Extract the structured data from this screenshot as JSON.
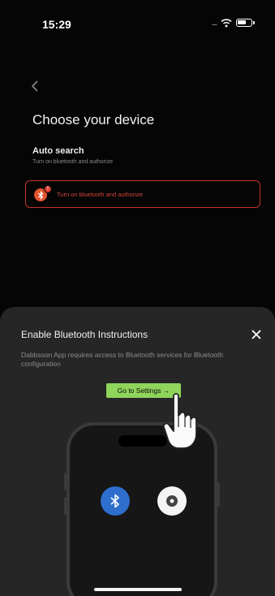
{
  "status_bar": {
    "time": "15:29",
    "signal": "....",
    "icons": [
      "signal-icon",
      "wifi-icon",
      "battery-icon"
    ]
  },
  "header": {
    "back_icon": "chevron-left-icon",
    "title": "Choose your device"
  },
  "auto_search": {
    "title": "Auto search",
    "subtitle": "Turn on bluetooth and authorize"
  },
  "bluetooth_button": {
    "label": "Turn on bluetooth and authorize",
    "icon": "bluetooth-alert-icon",
    "accent": "#d6453a"
  },
  "sheet": {
    "title": "Enable Bluetooth Instructions",
    "description": "Dabbsson App requires access to Bluetooth services for Bluetooth configuration",
    "settings_button": "Go to Settings →",
    "settings_accent": "#8fd45b",
    "close_icon": "close-icon",
    "illustration_icons": [
      "bluetooth-icon",
      "location-icon",
      "hand-pointer-icon"
    ]
  },
  "colors": {
    "background": "#050505",
    "sheet": "#262626",
    "bluetooth_blue": "#2e6fce"
  }
}
